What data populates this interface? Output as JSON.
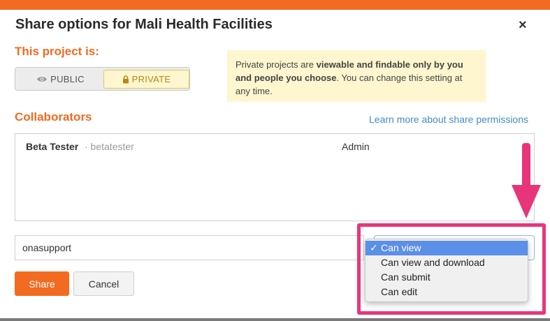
{
  "modal": {
    "title": "Share options for Mali Health Facilities",
    "close_symbol": "×"
  },
  "privacy": {
    "heading": "This project is:",
    "public_label": "PUBLIC",
    "private_label": "PRIVATE",
    "selected": "PRIVATE",
    "info_prefix": "Private projects are ",
    "info_bold": "viewable and findable only by you and people you choose",
    "info_suffix": ". You can change this setting at any time."
  },
  "collaborators": {
    "heading": "Collaborators",
    "learn_more_link": "Learn more about share permissions",
    "rows": [
      {
        "name": "Beta Tester",
        "username": "· betatester",
        "role": "Admin"
      }
    ]
  },
  "share_form": {
    "username_value": "onasupport",
    "permission_options": [
      "Can view",
      "Can view and download",
      "Can submit",
      "Can edit"
    ],
    "selected_permission": "Can view",
    "checkmark": "✓",
    "share_label": "Share",
    "cancel_label": "Cancel"
  },
  "icons": {
    "public": "eye-icon",
    "private": "lock-icon",
    "caret": "chevron-up-down-icon"
  },
  "colors": {
    "accent_orange": "#f26b21",
    "link_blue": "#3f8ec9",
    "private_bg": "#fdf6cf",
    "annotation_pink": "#e8357a",
    "dropdown_selected": "#5b8fe8"
  }
}
